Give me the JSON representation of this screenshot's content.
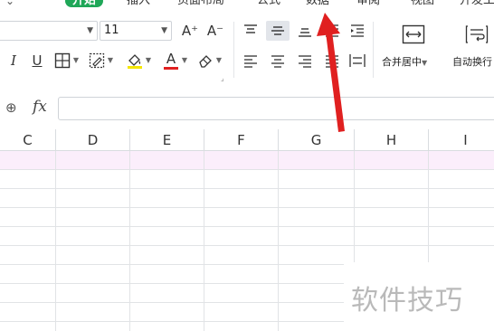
{
  "menu": {
    "back_icon": "back-arrow-icon",
    "tabs": [
      {
        "label": "开始",
        "active": true
      },
      {
        "label": "插入",
        "active": false
      },
      {
        "label": "页面布局",
        "active": false
      },
      {
        "label": "公式",
        "active": false
      },
      {
        "label": "数据",
        "active": false
      },
      {
        "label": "审阅",
        "active": false
      },
      {
        "label": "视图",
        "active": false
      },
      {
        "label": "开发工",
        "active": false
      }
    ]
  },
  "ribbon": {
    "font_size_value": "11",
    "increase_font_glyph": "A⁺",
    "decrease_font_glyph": "A⁻",
    "italic_glyph": "I",
    "underline_glyph": "U",
    "font_color_glyph": "A",
    "merge_center_label": "合并居中",
    "wrap_text_label": "自动换行"
  },
  "formula_bar": {
    "fx_label": "fx",
    "value": ""
  },
  "grid": {
    "columns": [
      "C",
      "D",
      "E",
      "F",
      "G",
      "H",
      "I"
    ]
  },
  "watermark": {
    "text": "软件技巧"
  },
  "colors": {
    "active_tab": "#1fa758",
    "highlight_row": "#fbeefb",
    "arrow": "#e02020",
    "font_color_underline": "#e02020",
    "fill_color_underline": "#f5e600"
  }
}
